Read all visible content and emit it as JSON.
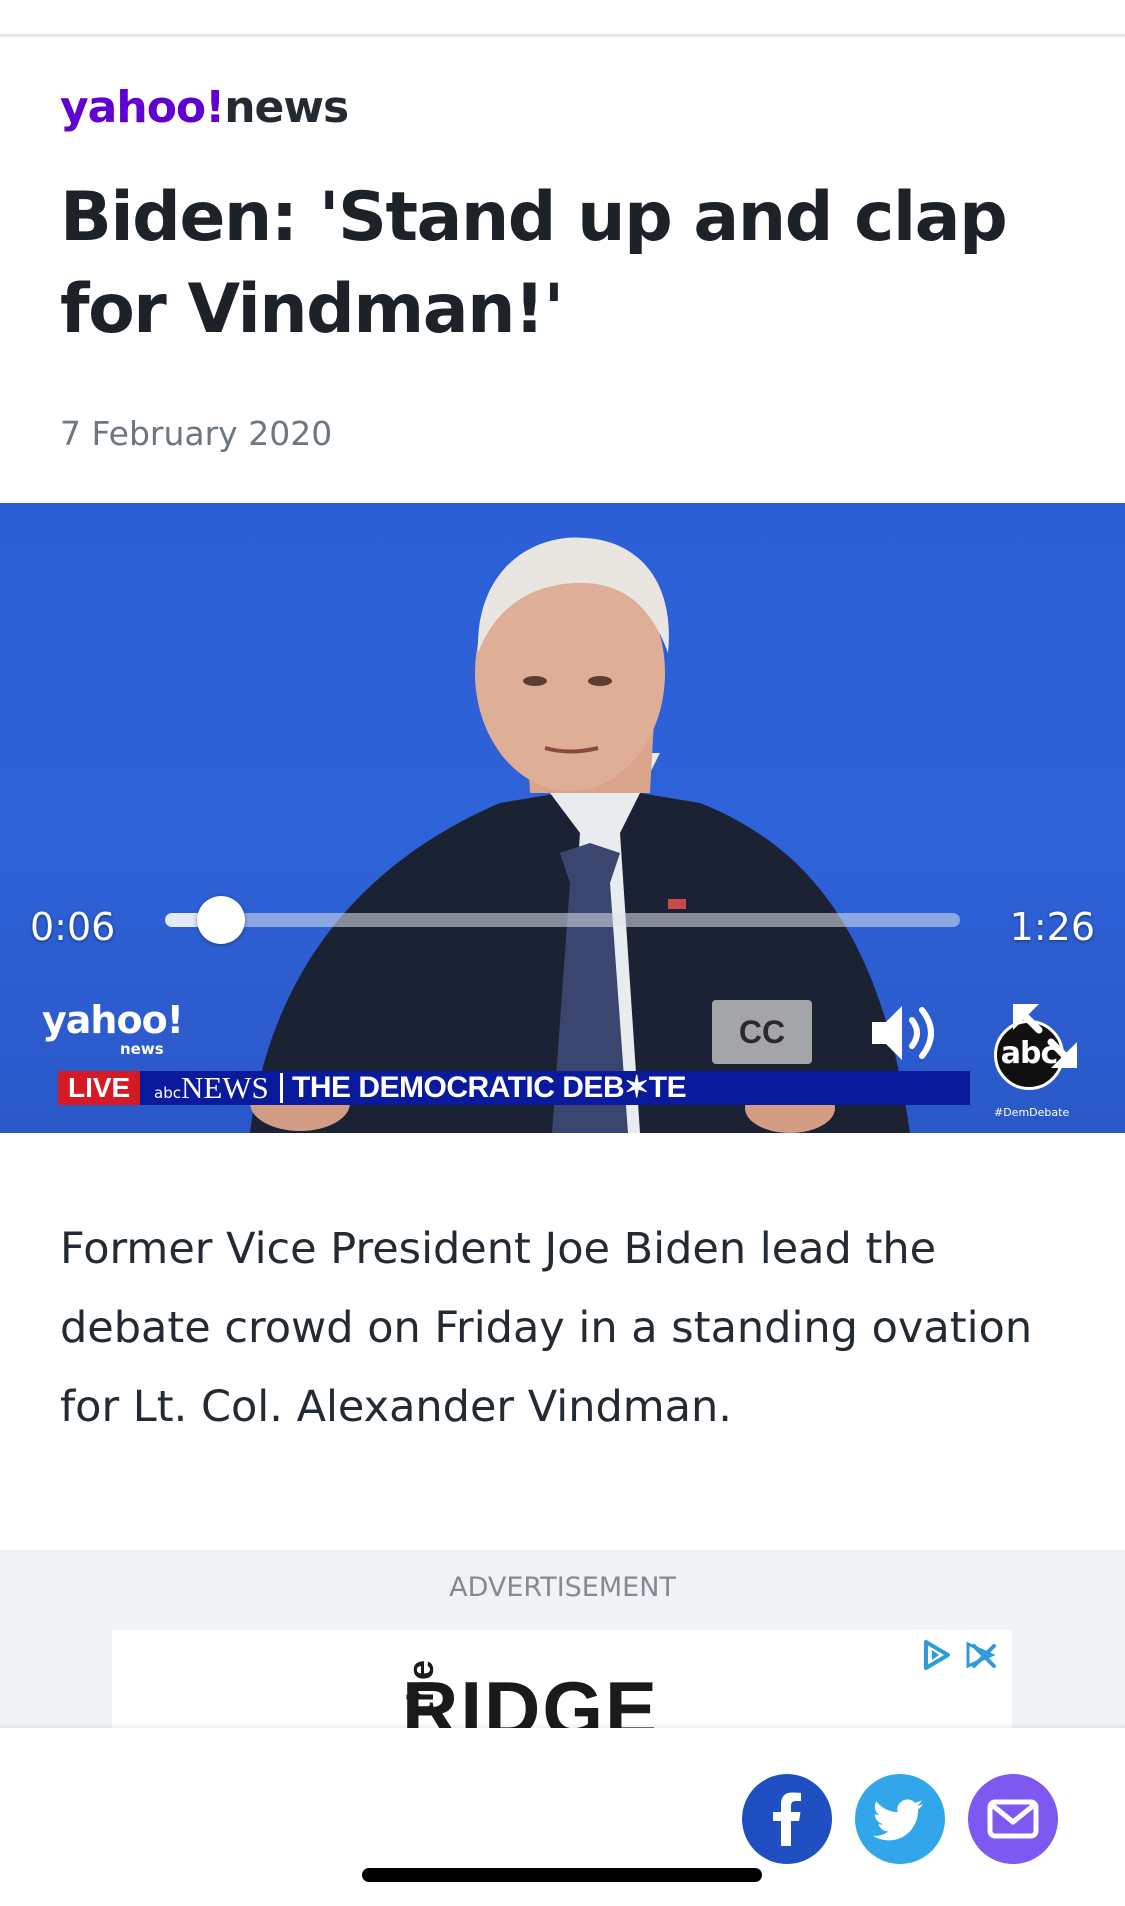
{
  "publisher": {
    "brand_yahoo": "yahoo!",
    "brand_news": "news"
  },
  "article": {
    "headline": "Biden: 'Stand up and clap for Vindman!'",
    "date": "7 February 2020",
    "summary": "Former Vice President Joe Biden lead the debate crowd on Friday in a standing ovation for Lt. Col. Alexander Vindman."
  },
  "video": {
    "current_time": "0:06",
    "total_time": "1:26",
    "progress_fraction": 0.07,
    "cc_label": "CC",
    "chyron": {
      "live": "LIVE",
      "network": "NEWS",
      "network_prefix": "abc",
      "title": "THE DEMOCRATIC DEB✶TE"
    },
    "watermark": {
      "main": "yahoo!",
      "sub": "news"
    },
    "abc_logo": "abc",
    "abc_tag": "#DemDebate"
  },
  "advertisement": {
    "label": "ADVERTISEMENT",
    "banner_text": "RIDGE",
    "banner_prefix": "the"
  },
  "share": {
    "facebook_icon": "facebook-icon",
    "twitter_icon": "twitter-icon",
    "email_icon": "email-icon"
  },
  "colors": {
    "brand_purple": "#6001d2",
    "facebook": "#1f4fc1",
    "twitter": "#32a6ea",
    "email": "#7d58f1",
    "video_background": "#2c5fd6"
  }
}
